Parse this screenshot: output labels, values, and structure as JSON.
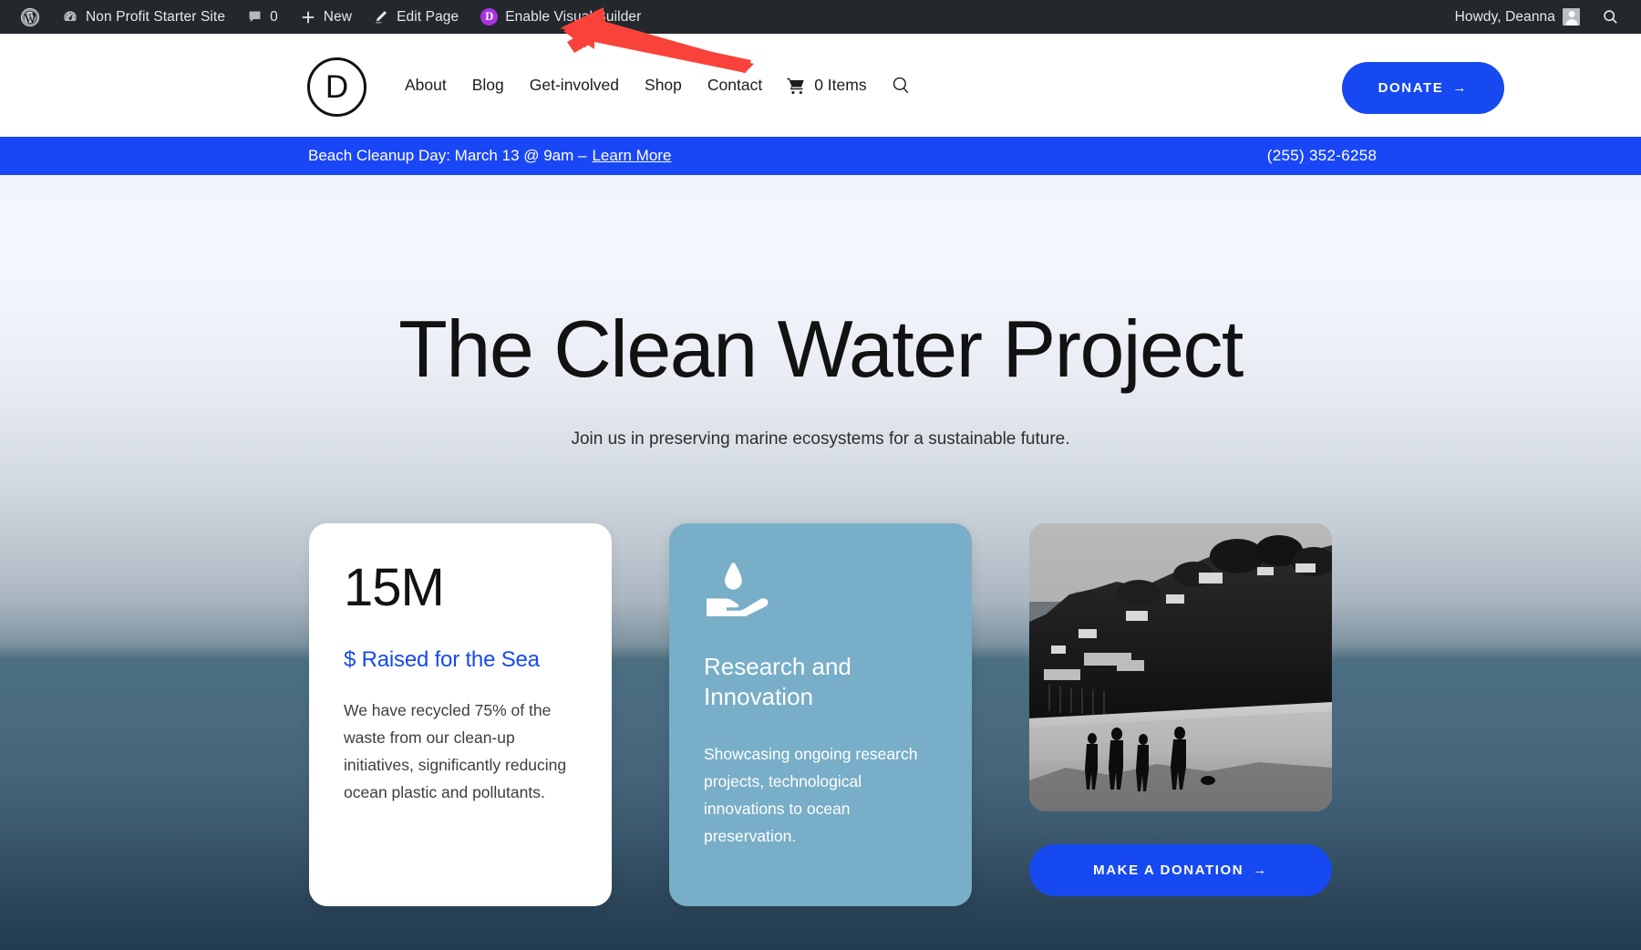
{
  "admin_bar": {
    "wp_logo_icon": "wordpress-logo-icon",
    "site_icon": "dashboard-gauge-icon",
    "site_name": "Non Profit Starter Site",
    "comments_icon": "comment-bubble-icon",
    "comments_count": "0",
    "new_icon": "plus-icon",
    "new_label": "New",
    "edit_icon": "pencil-icon",
    "edit_label": "Edit Page",
    "divi_badge": "D",
    "visual_builder_label": "Enable Visual Builder",
    "howdy_label": "Howdy, Deanna",
    "avatar_icon": "user-avatar-icon",
    "search_icon": "search-icon"
  },
  "header": {
    "logo_letter": "D",
    "nav_items": [
      {
        "label": "About"
      },
      {
        "label": "Blog"
      },
      {
        "label": "Get-involved"
      },
      {
        "label": "Shop"
      },
      {
        "label": "Contact"
      }
    ],
    "cart_icon": "shopping-cart-icon",
    "cart_label": "0 Items",
    "search_icon": "search-icon",
    "donate_label": "DONATE",
    "donate_arrow": "→"
  },
  "announcement": {
    "text": "Beach Cleanup Day: March 13 @ 9am –",
    "link_label": "Learn More",
    "phone": "(255) 352-6258",
    "background_color": "#1a47f5"
  },
  "hero": {
    "title": "The Clean Water Project",
    "subtitle": "Join us in preserving marine ecosystems for a sustainable future."
  },
  "cards": [
    {
      "type": "stat",
      "number": "15M",
      "label": "$ Raised for the Sea",
      "body": "We have recycled 75% of the waste from our clean-up initiatives, significantly reducing ocean plastic and pollutants.",
      "label_color": "#1749f0",
      "background_color": "#ffffff"
    },
    {
      "type": "feature",
      "icon": "hand-holding-water-drop-icon",
      "title": "Research and Innovation",
      "body": "Showcasing ongoing research projects, technological innovations to ocean preservation.",
      "background_color": "#78aec7"
    },
    {
      "type": "media",
      "image_alt": "black-and-white-photo-of-people-on-beach-with-hillside-houses",
      "button_label": "MAKE A DONATION",
      "button_arrow": "→",
      "button_color": "#1749f0"
    }
  ],
  "annotation": {
    "arrow_icon": "red-arrow-pointing-up-left",
    "arrow_color": "#f9423a"
  }
}
